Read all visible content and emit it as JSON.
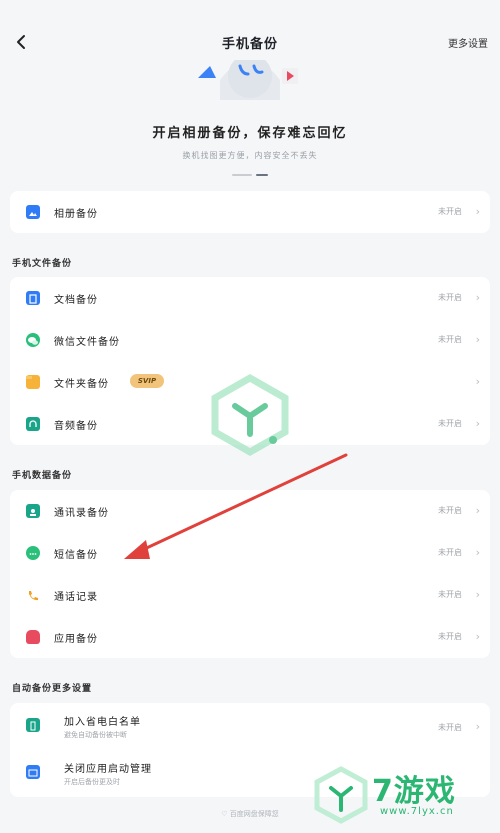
{
  "header": {
    "title": "手机备份",
    "more": "更多设置"
  },
  "hero": {
    "title": "开启相册备份，保存难忘回忆",
    "subtitle": "换机找图更方便，内容安全不丢失"
  },
  "album": {
    "label": "相册备份",
    "status": "未开启"
  },
  "file_section": {
    "title": "手机文件备份",
    "items": [
      {
        "label": "文档备份",
        "status": "未开启",
        "icon": "document-icon",
        "color": "#2f7cf6"
      },
      {
        "label": "微信文件备份",
        "status": "未开启",
        "icon": "wechat-icon",
        "color": "#2bc07a"
      },
      {
        "label": "文件夹备份",
        "status": "",
        "badge": "SVIP",
        "icon": "folder-icon",
        "color": "#f7b23a"
      },
      {
        "label": "音频备份",
        "status": "未开启",
        "icon": "audio-icon",
        "color": "#1aa58a"
      }
    ]
  },
  "data_section": {
    "title": "手机数据备份",
    "items": [
      {
        "label": "通讯录备份",
        "status": "未开启",
        "icon": "contacts-icon",
        "color": "#1aa58a"
      },
      {
        "label": "短信备份",
        "status": "未开启",
        "icon": "sms-icon",
        "color": "#2bc07a"
      },
      {
        "label": "通话记录",
        "status": "未开启",
        "icon": "phone-icon",
        "color": "#f0a020"
      },
      {
        "label": "应用备份",
        "status": "未开启",
        "icon": "app-icon",
        "color": "#e84a5f"
      }
    ]
  },
  "settings_section": {
    "title": "自动备份更多设置",
    "items": [
      {
        "label": "加入省电白名单",
        "sub": "避免自动备份被中断",
        "status": "未开启",
        "icon": "battery-icon",
        "color": "#1aa58a"
      },
      {
        "label": "关闭应用启动管理",
        "sub": "开启后备份更及时",
        "status": "",
        "icon": "app-manage-icon",
        "color": "#2f7cf6"
      }
    ]
  },
  "footer": {
    "note": "♡ 百度网盘保障您"
  },
  "brand": {
    "name": "7游戏",
    "url": "www.7lyx.cn"
  }
}
